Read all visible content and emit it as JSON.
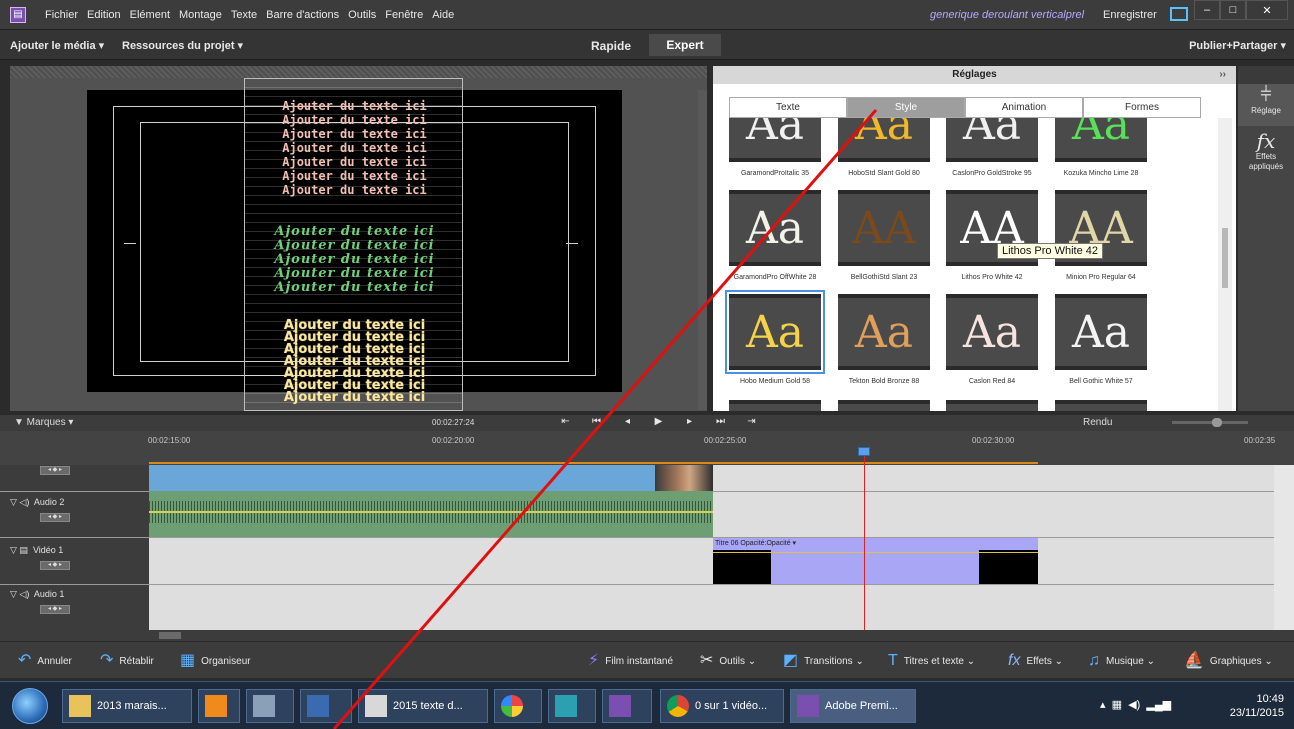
{
  "menu": {
    "items": [
      "Fichier",
      "Edition",
      "Elément",
      "Montage",
      "Texte",
      "Barre d'actions",
      "Outils",
      "Fenêtre",
      "Aide"
    ],
    "project_title": "generique deroulant verticalprel",
    "save": "Enregistrer"
  },
  "toolbar": {
    "add_media": "Ajouter le média ▾",
    "resources": "Ressources du projet ▾",
    "quick": "Rapide",
    "expert": "Expert",
    "publish": "Publier+Partager ▾"
  },
  "monitor": {
    "text_lines_salmon": [
      "Ajouter du texte ici",
      "Ajouter du texte ici",
      "Ajouter du texte ici",
      "Ajouter du texte ici",
      "Ajouter du texte ici",
      "Ajouter du texte ici",
      "Ajouter du texte ici"
    ],
    "text_lines_green": [
      "Ajouter du texte ici",
      "Ajouter du texte ici",
      "Ajouter du texte ici",
      "Ajouter du texte ici",
      "Ajouter du texte ici"
    ],
    "text_lines_gold": [
      "Ajouter du texte ici",
      "Ajouter du texte ici",
      "Ajouter du texte ici",
      "Ajouter du texte ici",
      "Ajouter du texte ici",
      "Ajouter du texte ici",
      "Ajouter du texte ici"
    ]
  },
  "settings": {
    "header": "Réglages",
    "collapse": "››",
    "tabs": [
      "Texte",
      "Style",
      "Animation",
      "Formes"
    ],
    "active_tab": "Style",
    "styles": [
      {
        "name": "GaramondProItalic 35",
        "sample": "Aa",
        "color": "#f0f0f0"
      },
      {
        "name": "HoboStd Slant Gold 80",
        "sample": "Aa",
        "color": "#f2b829"
      },
      {
        "name": "CaslonPro GoldStroke 95",
        "sample": "Aa",
        "color": "#f0f0f0"
      },
      {
        "name": "Kozuka Mincho Lime 28",
        "sample": "Aa",
        "color": "#58e25a"
      },
      {
        "name": "GaramondPro OffWhite 28",
        "sample": "Aa",
        "color": "#f2f2ea"
      },
      {
        "name": "BellGothiStd Slant 23",
        "sample": "AA",
        "color": "#7a4a1a"
      },
      {
        "name": "Lithos Pro White 42",
        "sample": "AA",
        "color": "#ffffff"
      },
      {
        "name": "Minion Pro Regular 64",
        "sample": "AA",
        "color": "#e2d5a8"
      },
      {
        "name": "Hobo Medium Gold 58",
        "sample": "Aa",
        "color": "#f6d24a"
      },
      {
        "name": "Tekton Bold Bronze 88",
        "sample": "Aa",
        "color": "#e0a05a"
      },
      {
        "name": "Caslon Red 84",
        "sample": "Aa",
        "color": "#f7e4e0"
      },
      {
        "name": "Bell Gothic White 57",
        "sample": "Aa",
        "color": "#f4f4f4"
      }
    ],
    "tooltip": "Lithos Pro White 42"
  },
  "rail": {
    "reglage": "Réglage",
    "effets": "Effets appliqués"
  },
  "timeline": {
    "markers": "▼ Marques  ▾",
    "timecode": "00:02:27:24",
    "rendu": "Rendu",
    "ruler": [
      "00:02:15:00",
      "00:02:20:00",
      "00:02:25:00",
      "00:02:30:00",
      "00:02:35"
    ],
    "tracks": {
      "audio2": "Audio 2",
      "video1": "Vidéo 1",
      "audio1": "Audio 1"
    },
    "title_clip": "Titre 06  Opacité:Opacité ▾"
  },
  "actions": {
    "undo": "Annuler",
    "redo": "Rétablir",
    "organizer": "Organiseur",
    "instant_movie": "Film instantané",
    "tools": "Outils ⌄",
    "transitions": "Transitions ⌄",
    "titles": "Titres et texte ⌄",
    "effects": "Effets ⌄",
    "music": "Musique ⌄",
    "graphics": "Graphiques ⌄"
  },
  "taskbar": {
    "items": [
      "2013 marais...",
      "2015 texte d...",
      "0 sur 1 vidéo...",
      "Adobe Premi..."
    ],
    "time": "10:49",
    "date": "23/11/2015"
  },
  "colors": {
    "accent_purple": "#7a4fb0",
    "selection_blue": "#4a8fe0",
    "annotation_red": "#e01010"
  }
}
